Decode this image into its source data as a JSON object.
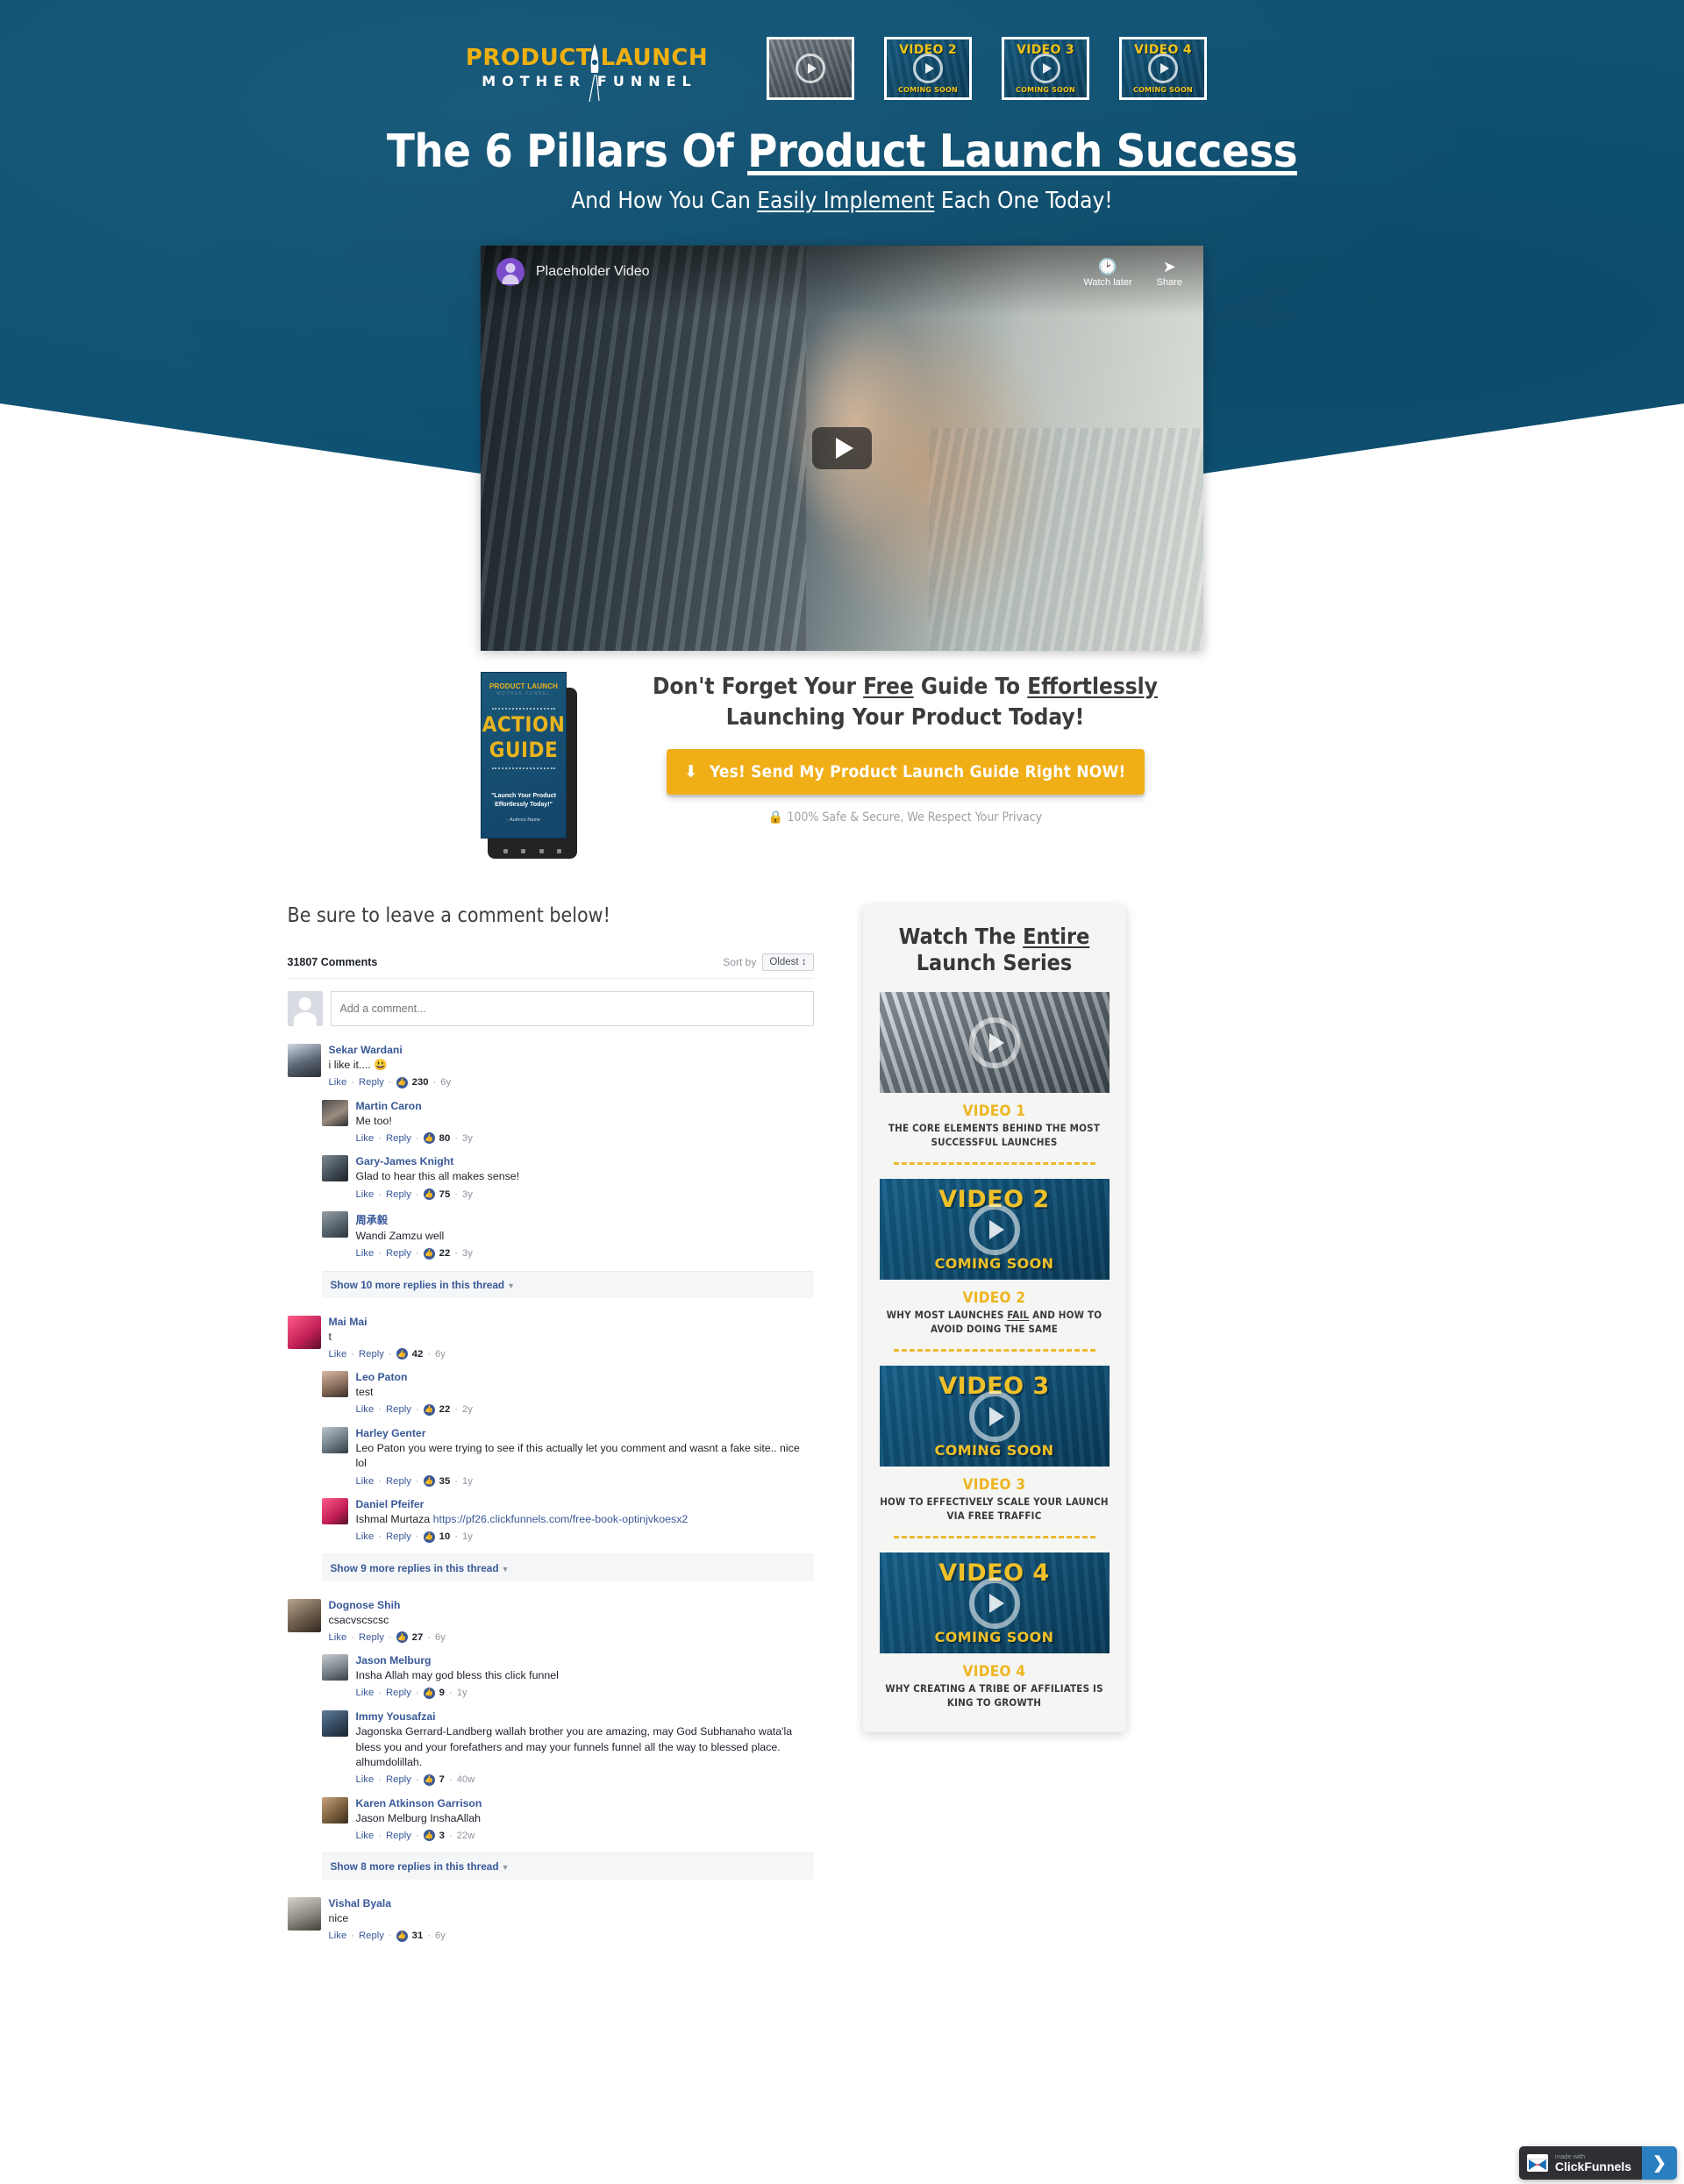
{
  "brand": {
    "logo_top": "PRODUCT LAUNCH",
    "logo_bottom": "MOTHER FUNNEL",
    "accent_yellow": "#edb51f",
    "brand_blue": "#0f5274"
  },
  "header": {
    "thumbs": [
      {
        "title": "",
        "subtitle": "",
        "kind": "photo"
      },
      {
        "title": "VIDEO 2",
        "subtitle": "COMING SOON",
        "kind": "soon"
      },
      {
        "title": "VIDEO 3",
        "subtitle": "COMING SOON",
        "kind": "soon"
      },
      {
        "title": "VIDEO 4",
        "subtitle": "COMING SOON",
        "kind": "soon"
      }
    ]
  },
  "hero": {
    "headline_plain": "The 6 Pillars Of ",
    "headline_underlined": "Product Launch Success",
    "sub_pre": "And How You Can ",
    "sub_underlined": "Easily Implement",
    "sub_post": " Each One Today!"
  },
  "player": {
    "title": "Placeholder Video",
    "watch_later": "Watch later",
    "share": "Share",
    "watch_later_icon": "clock-icon",
    "share_icon": "share-arrow-icon",
    "play_icon": "play-icon"
  },
  "cta": {
    "book": {
      "logo_top": "PRODUCT LAUNCH",
      "logo_bottom": "MOTHER FUNNEL",
      "word1": "ACTION",
      "word2": "GUIDE",
      "quote": "\"Launch Your Product Effortlessly Today!\"",
      "author": "- Authors Name"
    },
    "head_1": "Don't Forget Your ",
    "head_free": "Free",
    "head_2": " Guide To ",
    "head_eff": "Effortlessly",
    "head_line2": "Launching Your Product Today!",
    "button_label": "Yes! Send My Product Launch Guide Right NOW!",
    "button_icon": "download-icon",
    "safe_text": "100% Safe & Secure, We Respect Your Privacy",
    "safe_icon": "lock-icon"
  },
  "comments": {
    "section_heading": "Be sure to leave a comment below!",
    "count_label": "31807 Comments",
    "sort_by_label": "Sort by",
    "sort_value": "Oldest ↕",
    "add_placeholder": "Add a comment...",
    "like_label": "Like",
    "reply_label": "Reply",
    "threads": [
      {
        "name": "Sekar Wardani",
        "text": "i like it.... 😃",
        "likes": "230",
        "age": "6y",
        "avatar": "ph1",
        "replies": [
          {
            "name": "Martin Caron",
            "text": "Me too!",
            "likes": "80",
            "age": "3y",
            "avatar": "ph2"
          },
          {
            "name": "Gary-James Knight",
            "text": "Glad to hear this all makes sense!",
            "likes": "75",
            "age": "3y",
            "avatar": "ph3"
          },
          {
            "name": "周承毅",
            "text": "Wandi Zamzu well",
            "likes": "22",
            "age": "3y",
            "avatar": "ph4"
          }
        ],
        "show_more": "Show 10 more replies in this thread"
      },
      {
        "name": "Mai Mai",
        "text": "t",
        "likes": "42",
        "age": "6y",
        "avatar": "ph7",
        "replies": [
          {
            "name": "Leo Paton",
            "text": "test",
            "likes": "22",
            "age": "2y",
            "avatar": "ph5"
          },
          {
            "name": "Harley Genter",
            "text": "Leo Paton you were trying to see if this actually let you comment and wasnt a fake site.. nice lol",
            "likes": "35",
            "age": "1y",
            "avatar": "ph6"
          },
          {
            "name": "Daniel Pfeifer",
            "text": "Ishmal Murtaza ",
            "link": "https://pf26.clickfunnels.com/free-book-optinjvkoesx2",
            "likes": "10",
            "age": "1y",
            "avatar": "ph7"
          }
        ],
        "show_more": "Show 9 more replies in this thread"
      },
      {
        "name": "Dognose Shih",
        "text": "csacvscscsc",
        "likes": "27",
        "age": "6y",
        "avatar": "ph8",
        "replies": [
          {
            "name": "Jason Melburg",
            "text": "Insha Allah may god bless this click funnel",
            "likes": "9",
            "age": "1y",
            "avatar": "ph9"
          },
          {
            "name": "Immy Yousafzai",
            "text": "Jagonska Gerrard-Landberg wallah brother you are amazing, may God Subhanaho wata'la bless you and your forefathers and may your funnels funnel all the way to blessed place. alhumdolillah.",
            "likes": "7",
            "age": "40w",
            "avatar": "ph10"
          },
          {
            "name": "Karen Atkinson Garrison",
            "text": "Jason Melburg InshaAllah",
            "likes": "3",
            "age": "22w",
            "avatar": "ph11"
          }
        ],
        "show_more": "Show 8 more replies in this thread"
      },
      {
        "name": "Vishal Byala",
        "text": "nice",
        "likes": "31",
        "age": "6y",
        "avatar": "ph12",
        "replies": [],
        "show_more": ""
      }
    ]
  },
  "sidebar": {
    "title_1": "Watch The ",
    "title_underlined": "Entire",
    "title_2": "Launch Series",
    "videos": [
      {
        "kind": "photo",
        "thumb_title": "",
        "thumb_sub": "",
        "number": "VIDEO 1",
        "desc_pre": "THE CORE ELEMENTS BEHIND THE MOST SUCCESSFUL LAUNCHES",
        "desc_underlined": "",
        "desc_post": ""
      },
      {
        "kind": "soon",
        "thumb_title": "VIDEO 2",
        "thumb_sub": "COMING SOON",
        "number": "VIDEO 2",
        "desc_pre": "WHY MOST LAUNCHES ",
        "desc_underlined": "FAIL",
        "desc_post": " AND HOW TO AVOID DOING THE SAME"
      },
      {
        "kind": "soon",
        "thumb_title": "VIDEO 3",
        "thumb_sub": "COMING SOON",
        "number": "VIDEO 3",
        "desc_pre": "HOW TO EFFECTIVELY SCALE YOUR LAUNCH VIA FREE TRAFFIC",
        "desc_underlined": "",
        "desc_post": ""
      },
      {
        "kind": "soon",
        "thumb_title": "VIDEO 4",
        "thumb_sub": "COMING SOON",
        "number": "VIDEO 4",
        "desc_pre": "WHY CREATING A TRIBE OF AFFILIATES IS KING TO GROWTH",
        "desc_underlined": "",
        "desc_post": ""
      }
    ]
  },
  "footer_badge": {
    "made_with": "made with",
    "name": "ClickFunnels",
    "arrow": "❯",
    "logo_icon": "clickfunnels-logo-icon"
  }
}
